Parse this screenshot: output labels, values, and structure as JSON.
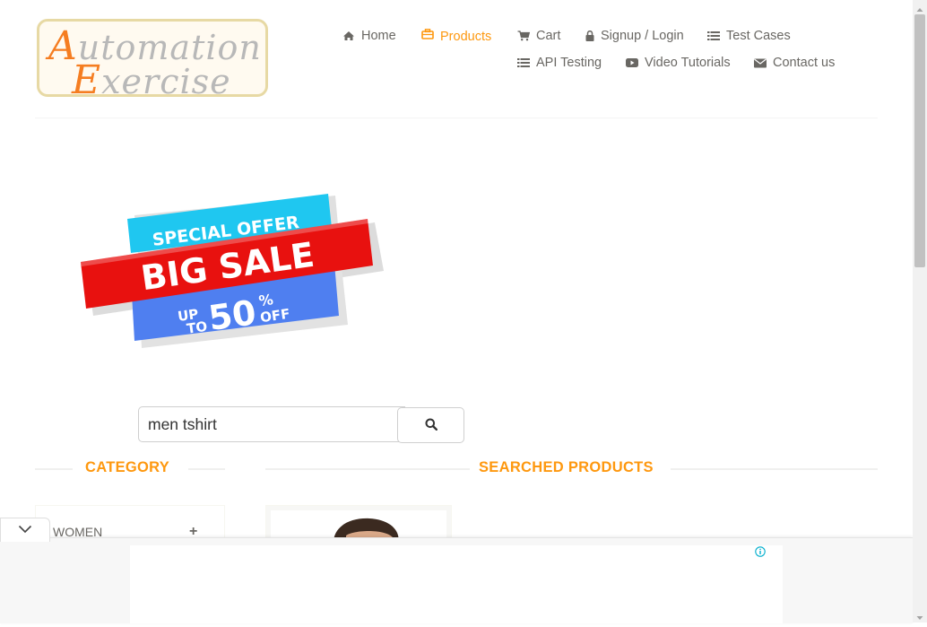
{
  "logo": {
    "line1_cap": "A",
    "line1_rest": "utomation",
    "line2_cap": "E",
    "line2_rest": "xercise"
  },
  "nav": {
    "items": [
      {
        "label": "Home",
        "icon": "home-icon"
      },
      {
        "label": "Products",
        "icon": "briefcase-icon",
        "active": true
      },
      {
        "label": "Cart",
        "icon": "cart-icon"
      },
      {
        "label": "Signup / Login",
        "icon": "lock-icon"
      },
      {
        "label": "Test Cases",
        "icon": "list-icon"
      },
      {
        "label": "API Testing",
        "icon": "list-icon"
      },
      {
        "label": "Video Tutorials",
        "icon": "youtube-play-icon"
      },
      {
        "label": "Contact us",
        "icon": "envelope-icon"
      }
    ]
  },
  "banner": {
    "line1": "SPECIAL OFFER",
    "line2": "BIG SALE",
    "line3a": "UP",
    "line3b": "TO",
    "line3c": "50",
    "line3d": "%",
    "line3e": "OFF"
  },
  "search": {
    "value": "men tshirt",
    "button_icon": "search-icon"
  },
  "sections": {
    "category_title": "CATEGORY",
    "products_title": "SEARCHED PRODUCTS"
  },
  "category": {
    "items": [
      {
        "label": "WOMEN",
        "toggle": "+"
      }
    ]
  },
  "ad": {
    "info_icon": "info-icon",
    "collapse_icon": "chevron-down-icon"
  },
  "colors": {
    "accent": "#fe980f",
    "logo_orange": "#f57d21",
    "text": "#696763",
    "banner_cyan": "#1fc7f0",
    "banner_red": "#e8110f",
    "banner_blue": "#4f7ff0"
  }
}
